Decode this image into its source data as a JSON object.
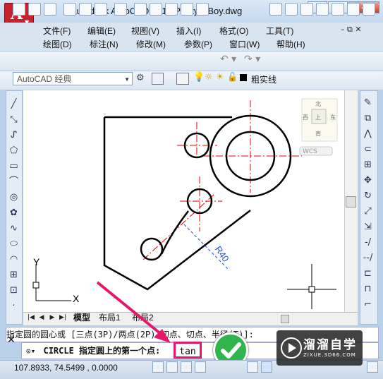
{
  "window": {
    "title": "Autodesk AutoCAD 2014     Pretty—Boy.dwg",
    "logo": "A"
  },
  "window_controls": {
    "minimize": "–",
    "restore": "□",
    "close": "X"
  },
  "menu": {
    "row1": [
      "文件(F)",
      "编辑(E)",
      "视图(V)",
      "插入(I)",
      "格式(O)",
      "工具(T)"
    ],
    "row2": [
      "绘图(D)",
      "标注(N)",
      "修改(M)",
      "参数(P)",
      "窗口(W)",
      "帮助(H)"
    ]
  },
  "toolbar": {
    "workspace": "AutoCAD 经典",
    "linetype": "粗实线"
  },
  "viewcube": {
    "north": "北",
    "south": "南",
    "east": "东",
    "west": "西",
    "top": "上",
    "wcs": "WCS"
  },
  "drawing": {
    "dimension": "R40",
    "ucs_x": "X",
    "ucs_y": "Y"
  },
  "tabs": {
    "model": "模型",
    "layout1": "布局1",
    "layout2": "布局2"
  },
  "command": {
    "history": "指定圆的圆心或 [三点(3P)/两点(2P)/切点、切点、半径(T)]:",
    "prompt": "CIRCLE 指定圆上的第一个点:",
    "input": "tan"
  },
  "status": {
    "coords": "107.8933, 74.5499 , 0.0000"
  },
  "watermark": {
    "title": "溜溜自学",
    "url": "ZIXUE.3D66.COM"
  }
}
